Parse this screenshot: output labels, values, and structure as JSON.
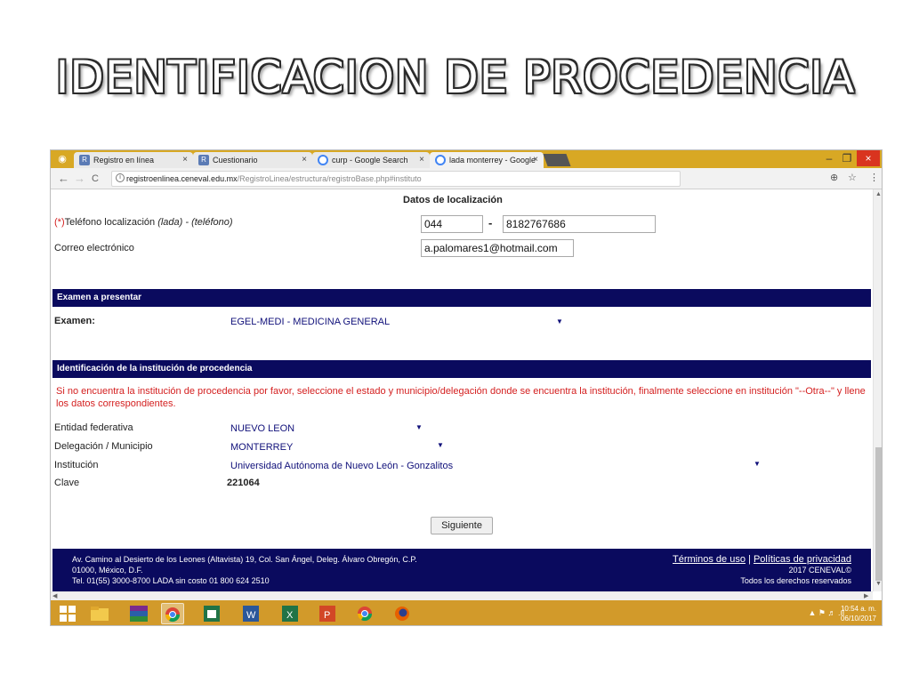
{
  "slide": {
    "title": "IDENTIFICACION DE PROCEDENCIA"
  },
  "browser": {
    "tabs": [
      {
        "label": "Registro en línea",
        "icon": "registro-icon"
      },
      {
        "label": "Cuestionario",
        "icon": "registro-icon"
      },
      {
        "label": "curp - Google Search",
        "icon": "google-icon"
      },
      {
        "label": "lada monterrey - Google",
        "icon": "google-icon"
      }
    ],
    "tab_close": "×",
    "window": {
      "minimize": "–",
      "maximize": "❐",
      "close": "×"
    },
    "address": {
      "host": "registroenlinea.ceneval.edu.mx",
      "path": "/RegistroLinea/estructura/registroBase.php#instituto"
    },
    "nav": {
      "back": "←",
      "forward": "→",
      "reload": "C"
    },
    "toolbar_icons": {
      "zoom": "⊕",
      "star": "☆",
      "menu": "⋮"
    }
  },
  "form": {
    "localizacion": {
      "title": "Datos de localización",
      "phone_label_req": "(*)",
      "phone_label_main": "Teléfono localización",
      "phone_label_italic": "(lada) - (teléfono)",
      "phone_lada": "044",
      "phone_separator": "-",
      "phone_number": "8182767686",
      "email_label": "Correo electrónico",
      "email_value": "a.palomares1@hotmail.com"
    },
    "examen": {
      "header": "Examen a presentar",
      "label": "Examen:",
      "value": "EGEL-MEDI - MEDICINA GENERAL"
    },
    "institucion": {
      "header": "Identificación de la institución de procedencia",
      "warning": "Si no encuentra la institución de procedencia por favor, seleccione el estado y municipio/delegación donde se encuentra la institución, finalmente seleccione en institución \"--Otra--\" y llene los datos correspondientes.",
      "entidad_label": "Entidad federativa",
      "entidad_value": "NUEVO LEON",
      "municipio_label": "Delegación / Municipio",
      "municipio_value": "MONTERREY",
      "institucion_label": "Institución",
      "institucion_value": "Universidad Autónoma de Nuevo León - Gonzalitos",
      "clave_label": "Clave",
      "clave_value": "221064"
    },
    "submit_label": "Siguiente",
    "dropdown_arrow": "▼"
  },
  "footer": {
    "address_line1": "Av. Camino al Desierto de los Leones (Altavista) 19, Col. San Ángel, Deleg. Álvaro Obregón, C.P.",
    "address_line2": "01000, México, D.F.",
    "address_line3": "Tel. 01(55) 3000-8700 LADA sin costo 01 800 624 2510",
    "terms": "Términos de uso",
    "separator": "|",
    "privacy": "Políticas de privacidad",
    "copyright": "2017 CENEVAL©",
    "rights": "Todos los derechos reservados"
  },
  "taskbar": {
    "apps": [
      "windows-start-icon",
      "file-explorer-icon",
      "winrar-icon",
      "chrome-user-icon",
      "project-icon",
      "word-icon",
      "excel-icon",
      "powerpoint-icon",
      "chrome-icon",
      "firefox-icon"
    ],
    "time": "10:54 a. m.",
    "date": "06/10/2017"
  }
}
